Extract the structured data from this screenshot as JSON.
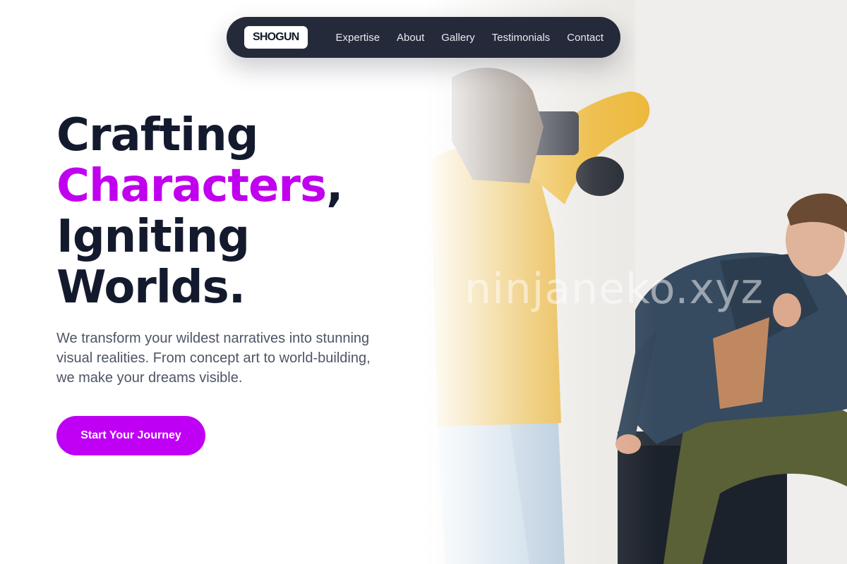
{
  "nav": {
    "brand": "SHOGUN",
    "links": [
      "Expertise",
      "About",
      "Gallery",
      "Testimonials",
      "Contact"
    ]
  },
  "hero": {
    "headline": {
      "line1": "Crafting",
      "line2_accent": "Characters",
      "line2_punct": ",",
      "line3": "Igniting",
      "line4": "Worlds."
    },
    "subtext": "We transform your wildest narratives into stunning visual realities. From concept art to world-building, we make your dreams visible.",
    "cta_label": "Start Your Journey",
    "watermark": "ninjaneko.xyz"
  },
  "colors": {
    "accent": "#c000ee",
    "cta": "#bf00f5",
    "nav_bg": "#252a3a",
    "heading": "#141a2e",
    "body_text": "#4e5566"
  },
  "photo": {
    "subject": "photographer in yellow sweater shooting a model in denim jacket sitting on a black box"
  }
}
